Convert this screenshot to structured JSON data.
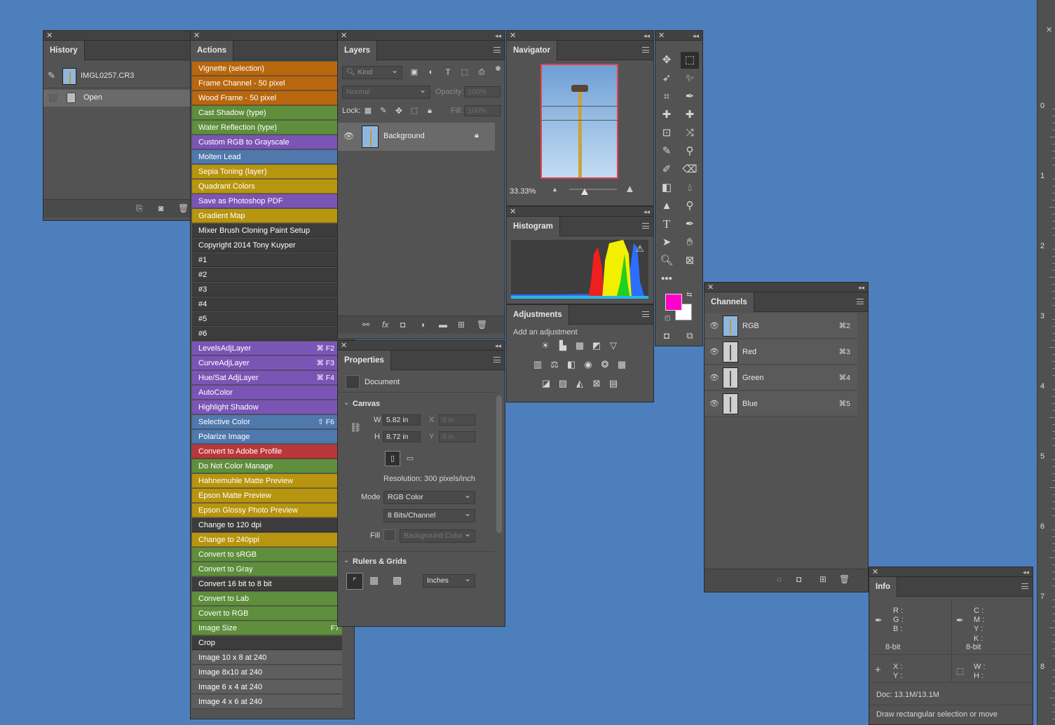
{
  "history": {
    "tab": "History",
    "snapshot": "IMGL0257.CR3",
    "step": "Open"
  },
  "actions": {
    "tab": "Actions",
    "items": [
      {
        "label": "Vignette (selection)",
        "color": "orange",
        "key": ""
      },
      {
        "label": "Frame Channel - 50 pixel",
        "color": "orange",
        "key": ""
      },
      {
        "label": "Wood Frame - 50 pixel",
        "color": "orange",
        "key": ""
      },
      {
        "label": "Cast Shadow (type)",
        "color": "green",
        "key": ""
      },
      {
        "label": "Water Reflection (type)",
        "color": "green",
        "key": ""
      },
      {
        "label": "Custom RGB to Grayscale",
        "color": "violet",
        "key": ""
      },
      {
        "label": "Molten Lead",
        "color": "blue",
        "key": ""
      },
      {
        "label": "Sepia Toning (layer)",
        "color": "yellow",
        "key": ""
      },
      {
        "label": "Quadrant Colors",
        "color": "yellow",
        "key": ""
      },
      {
        "label": "Save as Photoshop PDF",
        "color": "violet",
        "key": ""
      },
      {
        "label": "Gradient Map",
        "color": "yellow",
        "key": ""
      },
      {
        "label": "Mixer Brush Cloning Paint Setup",
        "color": "none",
        "key": ""
      },
      {
        "label": "Copyright 2014 Tony Kuyper",
        "color": "none",
        "key": ""
      },
      {
        "label": "#1",
        "color": "none",
        "key": ""
      },
      {
        "label": "#2",
        "color": "none",
        "key": ""
      },
      {
        "label": "#3",
        "color": "none",
        "key": ""
      },
      {
        "label": "#4",
        "color": "none",
        "key": ""
      },
      {
        "label": "#5",
        "color": "none",
        "key": ""
      },
      {
        "label": "#6",
        "color": "none",
        "key": ""
      },
      {
        "label": "LevelsAdjLayer",
        "color": "violet",
        "key": "⌘ F2"
      },
      {
        "label": "CurveAdjLayer",
        "color": "violet",
        "key": "⌘ F3"
      },
      {
        "label": "Hue/Sat AdjLayer",
        "color": "violet",
        "key": "⌘ F4"
      },
      {
        "label": "AutoColor",
        "color": "violet",
        "key": ""
      },
      {
        "label": "Highlight Shadow",
        "color": "violet",
        "key": ""
      },
      {
        "label": "Selective Color",
        "color": "blue",
        "key": "⇧ F6"
      },
      {
        "label": "Polarize Image",
        "color": "blue",
        "key": ""
      },
      {
        "label": "Convert to Adobe Profile",
        "color": "red",
        "key": ""
      },
      {
        "label": "Do Not Color Manage",
        "color": "green",
        "key": ""
      },
      {
        "label": "Hahnemuhle Matte Preview",
        "color": "yellow",
        "key": ""
      },
      {
        "label": "Epson Matte Preview",
        "color": "yellow",
        "key": ""
      },
      {
        "label": "Epson Glossy Photo Preview",
        "color": "yellow",
        "key": ""
      },
      {
        "label": "Change to 120 dpi",
        "color": "none",
        "key": ""
      },
      {
        "label": "Change to 240ppi",
        "color": "yellow",
        "key": ""
      },
      {
        "label": "Convert to sRGB",
        "color": "green",
        "key": ""
      },
      {
        "label": "Convert to Gray",
        "color": "green",
        "key": ""
      },
      {
        "label": "Convert 16 bit to 8 bit",
        "color": "none",
        "key": ""
      },
      {
        "label": "Convert to Lab",
        "color": "green",
        "key": ""
      },
      {
        "label": "Covert to RGB",
        "color": "green",
        "key": ""
      },
      {
        "label": "Image Size",
        "color": "green",
        "key": "F7"
      },
      {
        "label": "Crop",
        "color": "none",
        "key": ""
      },
      {
        "label": "Image 10 x 8 at 240",
        "color": "gray",
        "key": ""
      },
      {
        "label": "Image 8x10 at 240",
        "color": "gray",
        "key": ""
      },
      {
        "label": "Image 6 x 4 at 240",
        "color": "gray",
        "key": ""
      },
      {
        "label": "Image 4 x 6 at 240",
        "color": "gray",
        "key": ""
      }
    ]
  },
  "layers": {
    "tab": "Layers",
    "kind": "Kind",
    "blend": "Normal",
    "opacity_label": "Opacity:",
    "opacity": "100%",
    "lock_label": "Lock:",
    "fill_label": "Fill:",
    "fill": "100%",
    "layer_name": "Background"
  },
  "properties": {
    "tab": "Properties",
    "doc": "Document",
    "canvas": "Canvas",
    "w_label": "W",
    "w": "5.82 in",
    "h_label": "H",
    "h": "8.72 in",
    "x_label": "X",
    "x_ph": "0 in",
    "y_label": "Y",
    "y_ph": "0 in",
    "resolution": "Resolution: 300 pixels/inch",
    "mode_label": "Mode",
    "mode": "RGB Color",
    "bits": "8 Bits/Channel",
    "fill_label": "Fill",
    "fill": "Background Color",
    "rulers": "Rulers & Grids",
    "units": "Inches"
  },
  "navigator": {
    "tab": "Navigator",
    "zoom": "33.33%",
    "zoom_fraction": 0.33
  },
  "histogram": {
    "tab": "Histogram"
  },
  "adjustments": {
    "tab": "Adjustments",
    "hint": "Add an adjustment"
  },
  "tools": {
    "foreground": "#ff00cc",
    "background": "#ffffff"
  },
  "channels": {
    "tab": "Channels",
    "items": [
      {
        "name": "RGB",
        "shortcut": "⌘2"
      },
      {
        "name": "Red",
        "shortcut": "⌘3"
      },
      {
        "name": "Green",
        "shortcut": "⌘4"
      },
      {
        "name": "Blue",
        "shortcut": "⌘5"
      }
    ]
  },
  "info": {
    "tab": "Info",
    "r": "R :",
    "g": "G :",
    "b": "B :",
    "bit1": "8-bit",
    "c": "C :",
    "m": "M :",
    "y": "Y :",
    "k": "K :",
    "bit2": "8-bit",
    "x": "X :",
    "yy": "Y :",
    "w": "W :",
    "h": "H :",
    "doc": "Doc: 13.1M/13.1M",
    "status": "Draw rectangular selection or move"
  },
  "ruler": {
    "ticks": [
      "0",
      "1",
      "2",
      "3",
      "4",
      "5",
      "6",
      "7",
      "8"
    ]
  }
}
